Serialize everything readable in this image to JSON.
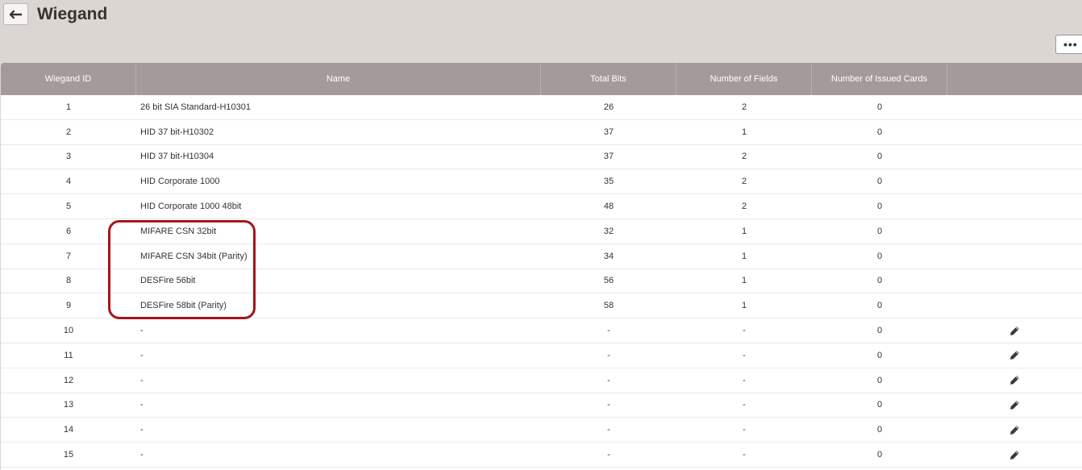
{
  "header": {
    "title": "Wiegand",
    "more_label": "•••"
  },
  "table": {
    "columns": [
      "Wiegand ID",
      "Name",
      "Total Bits",
      "Number of Fields",
      "Number of Issued Cards",
      ""
    ],
    "rows": [
      {
        "id": "1",
        "name": "26 bit SIA Standard-H10301",
        "bits": "26",
        "fields": "2",
        "cards": "0",
        "editable": false
      },
      {
        "id": "2",
        "name": "HID 37 bit-H10302",
        "bits": "37",
        "fields": "1",
        "cards": "0",
        "editable": false
      },
      {
        "id": "3",
        "name": "HID 37 bit-H10304",
        "bits": "37",
        "fields": "2",
        "cards": "0",
        "editable": false
      },
      {
        "id": "4",
        "name": "HID Corporate 1000",
        "bits": "35",
        "fields": "2",
        "cards": "0",
        "editable": false
      },
      {
        "id": "5",
        "name": "HID Corporate 1000 48bit",
        "bits": "48",
        "fields": "2",
        "cards": "0",
        "editable": false
      },
      {
        "id": "6",
        "name": "MIFARE CSN 32bit",
        "bits": "32",
        "fields": "1",
        "cards": "0",
        "editable": false
      },
      {
        "id": "7",
        "name": "MIFARE CSN 34bit (Parity)",
        "bits": "34",
        "fields": "1",
        "cards": "0",
        "editable": false
      },
      {
        "id": "8",
        "name": "DESFire 56bit",
        "bits": "56",
        "fields": "1",
        "cards": "0",
        "editable": false
      },
      {
        "id": "9",
        "name": "DESFire 58bit (Parity)",
        "bits": "58",
        "fields": "1",
        "cards": "0",
        "editable": false
      },
      {
        "id": "10",
        "name": "-",
        "bits": "-",
        "fields": "-",
        "cards": "0",
        "editable": true
      },
      {
        "id": "11",
        "name": "-",
        "bits": "-",
        "fields": "-",
        "cards": "0",
        "editable": true
      },
      {
        "id": "12",
        "name": "-",
        "bits": "-",
        "fields": "-",
        "cards": "0",
        "editable": true
      },
      {
        "id": "13",
        "name": "-",
        "bits": "-",
        "fields": "-",
        "cards": "0",
        "editable": true
      },
      {
        "id": "14",
        "name": "-",
        "bits": "-",
        "fields": "-",
        "cards": "0",
        "editable": true
      },
      {
        "id": "15",
        "name": "-",
        "bits": "-",
        "fields": "-",
        "cards": "0",
        "editable": true
      }
    ]
  },
  "icons": {
    "back": "arrow-left-icon",
    "edit": "pencil-icon"
  },
  "colors": {
    "header_bg": "#a49a9a",
    "page_bg": "#dbd6d2",
    "highlight": "#a8141b"
  }
}
